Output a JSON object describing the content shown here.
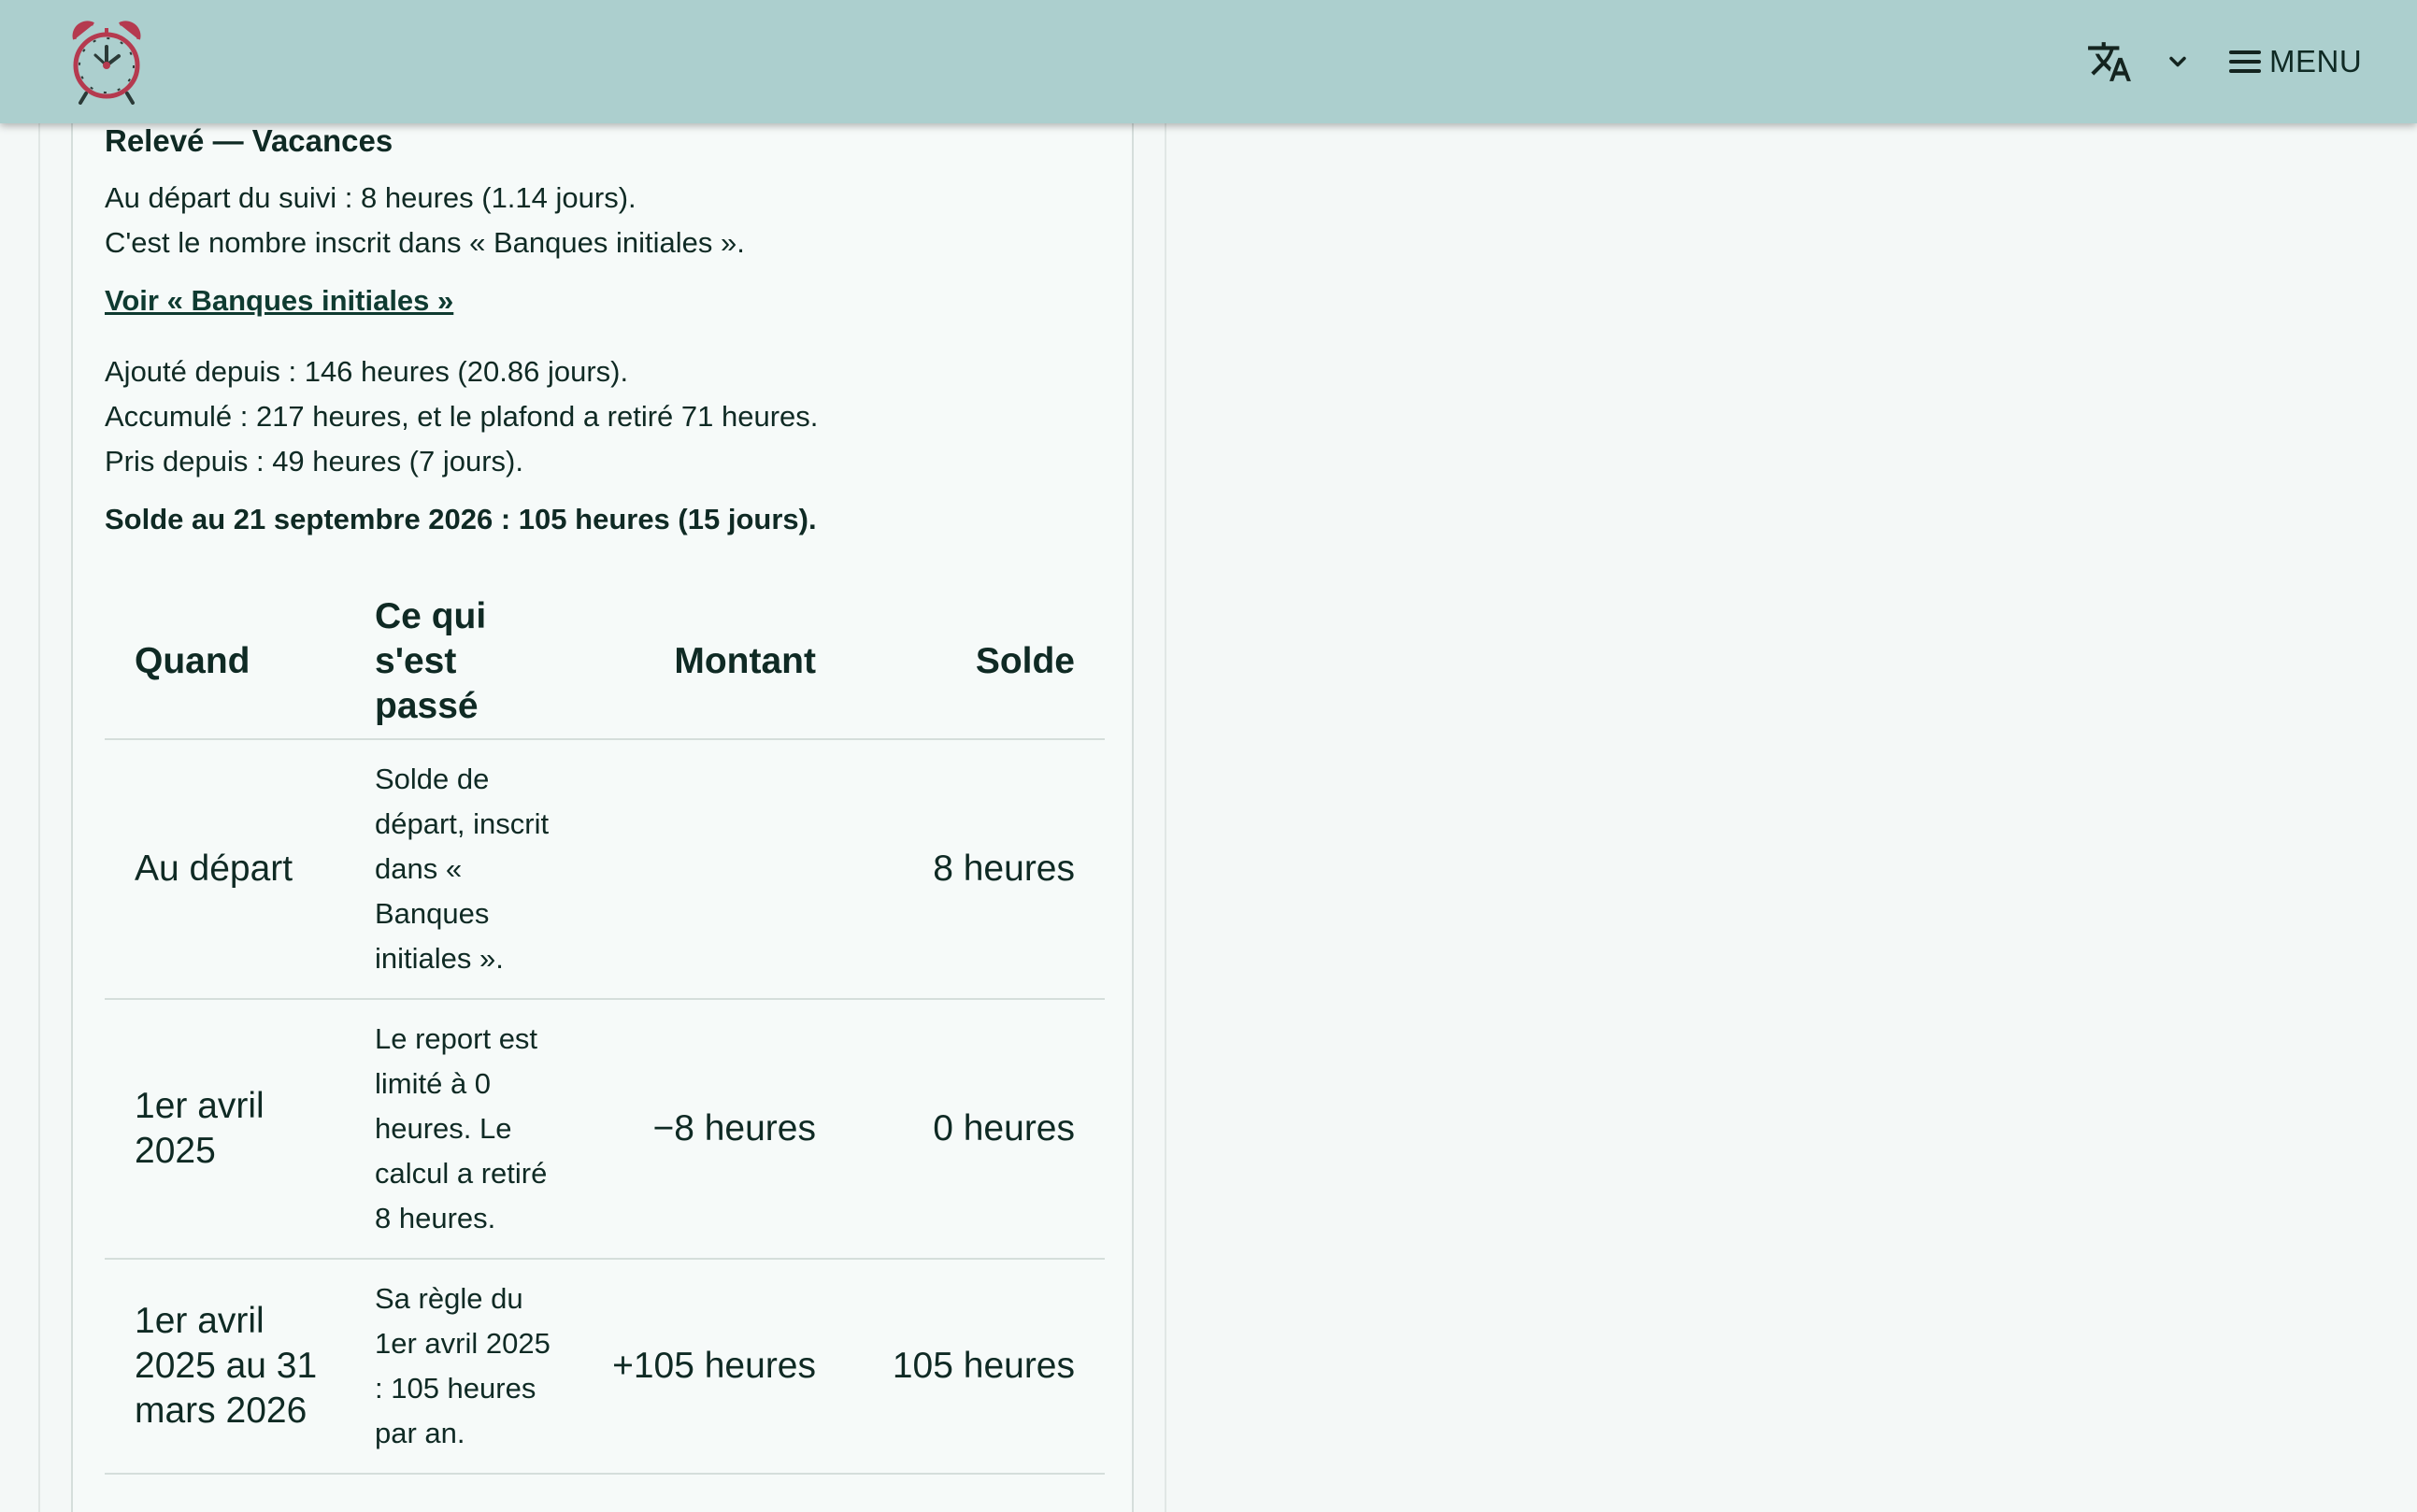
{
  "header": {
    "logo_icon": "alarm-clock-icon",
    "language_icon": "translate-icon",
    "language_chevron_icon": "chevron-down-icon",
    "menu_icon": "hamburger-icon",
    "menu_label": "MENU",
    "accent_color": "#accfce",
    "logo_color": "#b53a4f"
  },
  "report": {
    "title": "Relevé — Vacances",
    "start_line": "Au départ du suivi : 8 heures (1.14 jours).",
    "start_note": "C'est le nombre inscrit dans « Banques initiales ».",
    "link_label": "Voir « Banques initiales »",
    "added_line": "Ajouté depuis : 146 heures (20.86 jours).",
    "accumulated_line": "Accumulé : 217 heures, et le plafond a retiré 71 heures.",
    "taken_line": "Pris depuis : 49 heures (7 jours).",
    "balance_line": "Solde au 21 septembre 2026 : 105 heures (15 jours)."
  },
  "table": {
    "headers": {
      "when": "Quand",
      "what": "Ce qui s'est passé",
      "amount": "Montant",
      "balance": "Solde"
    },
    "rows": [
      {
        "when": "Au départ",
        "what": "Solde de départ, inscrit dans « Banques initiales ».",
        "amount": "",
        "balance": "8 heures"
      },
      {
        "when": "1er avril 2025",
        "what": "Le report est limité à 0 heures. Le calcul a retiré 8 heures.",
        "amount": "−8 heures",
        "balance": "0 heures"
      },
      {
        "when": "1er avril 2025 au 31 mars 2026",
        "what": "Sa règle du 1er avril 2025 : 105 heures par an.",
        "amount": "+105 heures",
        "balance": "105 heures"
      }
    ]
  }
}
